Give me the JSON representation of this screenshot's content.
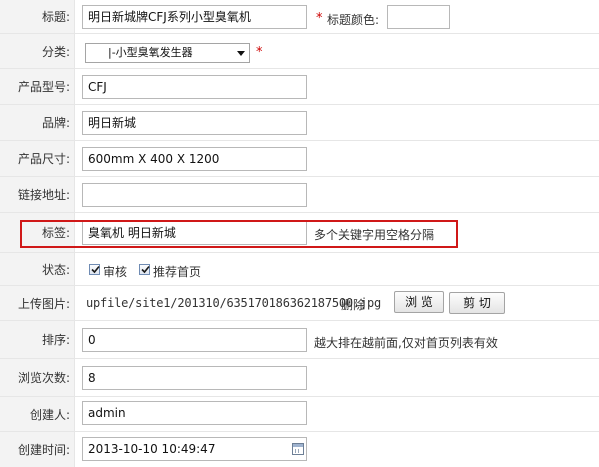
{
  "rows": {
    "title": {
      "label": "标题:",
      "value": "明日新城牌CFJ系列小型臭氧机",
      "required_mark": "*",
      "color_label": "标题颜色:",
      "color_value": ""
    },
    "category": {
      "label": "分类:",
      "selected": "|-小型臭氧发生器",
      "required_mark": "*"
    },
    "model": {
      "label": "产品型号:",
      "value": "CFJ"
    },
    "brand": {
      "label": "品牌:",
      "value": "明日新城"
    },
    "size": {
      "label": "产品尺寸:",
      "value": "600mm X 400 X 1200"
    },
    "link": {
      "label": "链接地址:",
      "value": ""
    },
    "tags": {
      "label": "标签:",
      "value": "臭氧机  明日新城",
      "hint": "多个关键字用空格分隔"
    },
    "status": {
      "label": "状态:",
      "audit_label": "审核",
      "audit_checked": true,
      "home_label": "推荐首页",
      "home_checked": true
    },
    "upload": {
      "label": "上传图片:",
      "path": "upfile/site1/201310/635170186362187500.jpg",
      "delete_label": "删除",
      "browse_label": "浏 览",
      "crop_label": "剪 切"
    },
    "sort": {
      "label": "排序:",
      "value": "0",
      "hint": "越大排在越前面,仅对首页列表有效"
    },
    "views": {
      "label": "浏览次数:",
      "value": "8"
    },
    "creator": {
      "label": "创建人:",
      "value": "admin"
    },
    "created": {
      "label": "创建时间:",
      "value": "2013-10-10 10:49:47"
    }
  },
  "colors": {
    "highlight": "#d01818",
    "required": "#cc0000",
    "label_bg": "#f3f3f3"
  }
}
